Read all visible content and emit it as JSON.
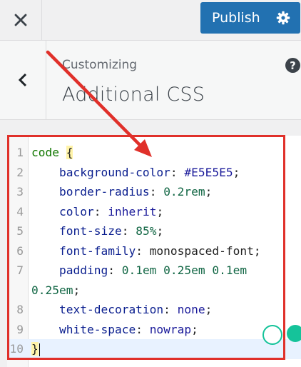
{
  "header": {
    "close_icon": "close-icon",
    "publish_label": "Publish",
    "gear_icon": "gear-icon",
    "publish_color": "#2271b1"
  },
  "section": {
    "subtitle": "Customizing",
    "title": "Additional CSS",
    "help": "?",
    "back_icon": "chevron-left-icon"
  },
  "editor": {
    "lines": [
      {
        "n": "1",
        "segments": [
          {
            "t": "code",
            "c": "sel"
          },
          {
            "t": " ",
            "c": "plain"
          },
          {
            "t": "{",
            "c": "brace"
          }
        ]
      },
      {
        "n": "2",
        "segments": [
          {
            "t": "    background-color",
            "c": "prop"
          },
          {
            "t": ": ",
            "c": "plain"
          },
          {
            "t": "#E5E5E5",
            "c": "kw"
          },
          {
            "t": ";",
            "c": "plain"
          }
        ]
      },
      {
        "n": "3",
        "segments": [
          {
            "t": "    border-radius",
            "c": "prop"
          },
          {
            "t": ": ",
            "c": "plain"
          },
          {
            "t": "0.2rem",
            "c": "val"
          },
          {
            "t": ";",
            "c": "plain"
          }
        ]
      },
      {
        "n": "4",
        "segments": [
          {
            "t": "    color",
            "c": "prop"
          },
          {
            "t": ": ",
            "c": "plain"
          },
          {
            "t": "inherit",
            "c": "kw"
          },
          {
            "t": ";",
            "c": "plain"
          }
        ]
      },
      {
        "n": "5",
        "segments": [
          {
            "t": "    font-size",
            "c": "prop"
          },
          {
            "t": ": ",
            "c": "plain"
          },
          {
            "t": "85%",
            "c": "val"
          },
          {
            "t": ";",
            "c": "plain"
          }
        ]
      },
      {
        "n": "6",
        "segments": [
          {
            "t": "    font-family",
            "c": "prop"
          },
          {
            "t": ": ",
            "c": "plain"
          },
          {
            "t": "monospaced-font",
            "c": "plain"
          },
          {
            "t": ";",
            "c": "plain"
          }
        ]
      },
      {
        "n": "7",
        "segments": [
          {
            "t": "    padding",
            "c": "prop"
          },
          {
            "t": ": ",
            "c": "plain"
          },
          {
            "t": "0.1em 0.25em 0.1em",
            "c": "val"
          }
        ]
      },
      {
        "n": "",
        "segments": [
          {
            "t": "0.25em",
            "c": "val"
          },
          {
            "t": ";",
            "c": "plain"
          }
        ],
        "wrap": true
      },
      {
        "n": "8",
        "segments": [
          {
            "t": "    text-decoration",
            "c": "prop"
          },
          {
            "t": ": ",
            "c": "plain"
          },
          {
            "t": "none",
            "c": "kw"
          },
          {
            "t": ";",
            "c": "plain"
          }
        ]
      },
      {
        "n": "9",
        "segments": [
          {
            "t": "    white-space",
            "c": "prop"
          },
          {
            "t": ": ",
            "c": "plain"
          },
          {
            "t": "nowrap",
            "c": "kw"
          },
          {
            "t": ";",
            "c": "plain"
          }
        ]
      },
      {
        "n": "10",
        "segments": [
          {
            "t": "}",
            "c": "brace"
          }
        ],
        "active": true,
        "cursor": true
      }
    ]
  },
  "annotation": {
    "color": "#e0302a",
    "icons": [
      "arrow-annotation",
      "highlight-box-annotation"
    ]
  },
  "floating_icons": [
    "grammarly-icon",
    "extension-icon"
  ]
}
